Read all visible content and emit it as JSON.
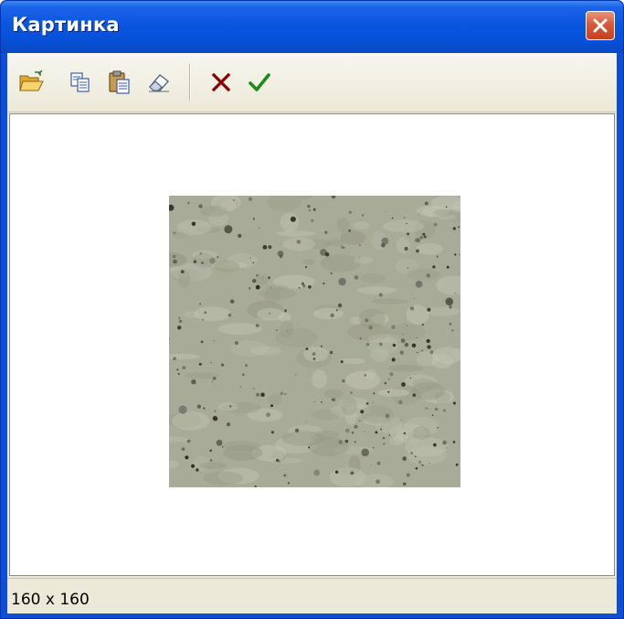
{
  "window": {
    "title": "Картинка"
  },
  "toolbar": {
    "buttons": [
      {
        "name": "open",
        "icon": "folder-open-icon"
      },
      {
        "name": "copy",
        "icon": "copy-icon"
      },
      {
        "name": "paste",
        "icon": "paste-icon"
      },
      {
        "name": "clear",
        "icon": "eraser-icon"
      },
      {
        "name": "cancel",
        "icon": "red-x-icon"
      },
      {
        "name": "ok",
        "icon": "green-check-icon"
      }
    ]
  },
  "image": {
    "description_colors": {
      "base": "#a8ab98",
      "speckle": "#3c3a2e"
    }
  },
  "status": {
    "dimensions": "160 x 160"
  },
  "colors": {
    "titlebar": "#0a56e0",
    "close_button": "#d8593a",
    "toolbar_bg": "#ece9d8",
    "cancel_icon": "#8b0000",
    "ok_icon": "#1a8c1a"
  }
}
